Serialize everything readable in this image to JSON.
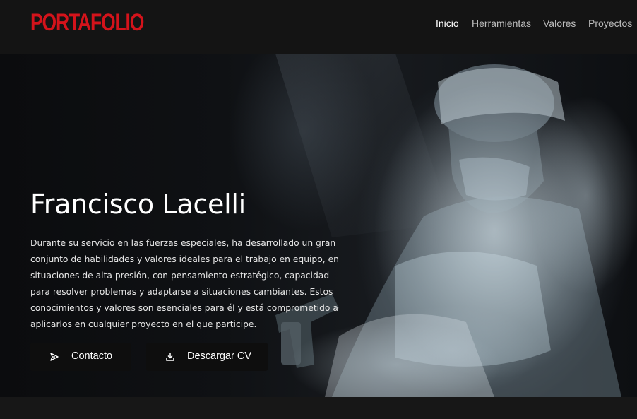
{
  "brand": {
    "logo_text": "PORTAFOLIO",
    "accent_color": "#d4131b"
  },
  "nav": {
    "items": [
      {
        "label": "Inicio",
        "active": true
      },
      {
        "label": "Herramientas",
        "active": false
      },
      {
        "label": "Valores",
        "active": false
      },
      {
        "label": "Proyectos",
        "active": false
      }
    ]
  },
  "hero": {
    "name": "Francisco Lacelli",
    "description": "Durante su servicio en las fuerzas especiales, ha desarrollado un gran conjunto de habilidades y valores ideales para el trabajo en equipo, en situaciones de alta presión, con pensamiento estratégico, capacidad para resolver problemas y adaptarse a situaciones cambiantes. Estos conocimientos y valores son esenciales para él y está comprometido a aplicarlos en cualquier proyecto en el que participe.",
    "buttons": {
      "contact_label": "Contacto",
      "contact_icon": "send-icon",
      "cv_label": "Descargar CV",
      "cv_icon": "download-icon"
    }
  }
}
